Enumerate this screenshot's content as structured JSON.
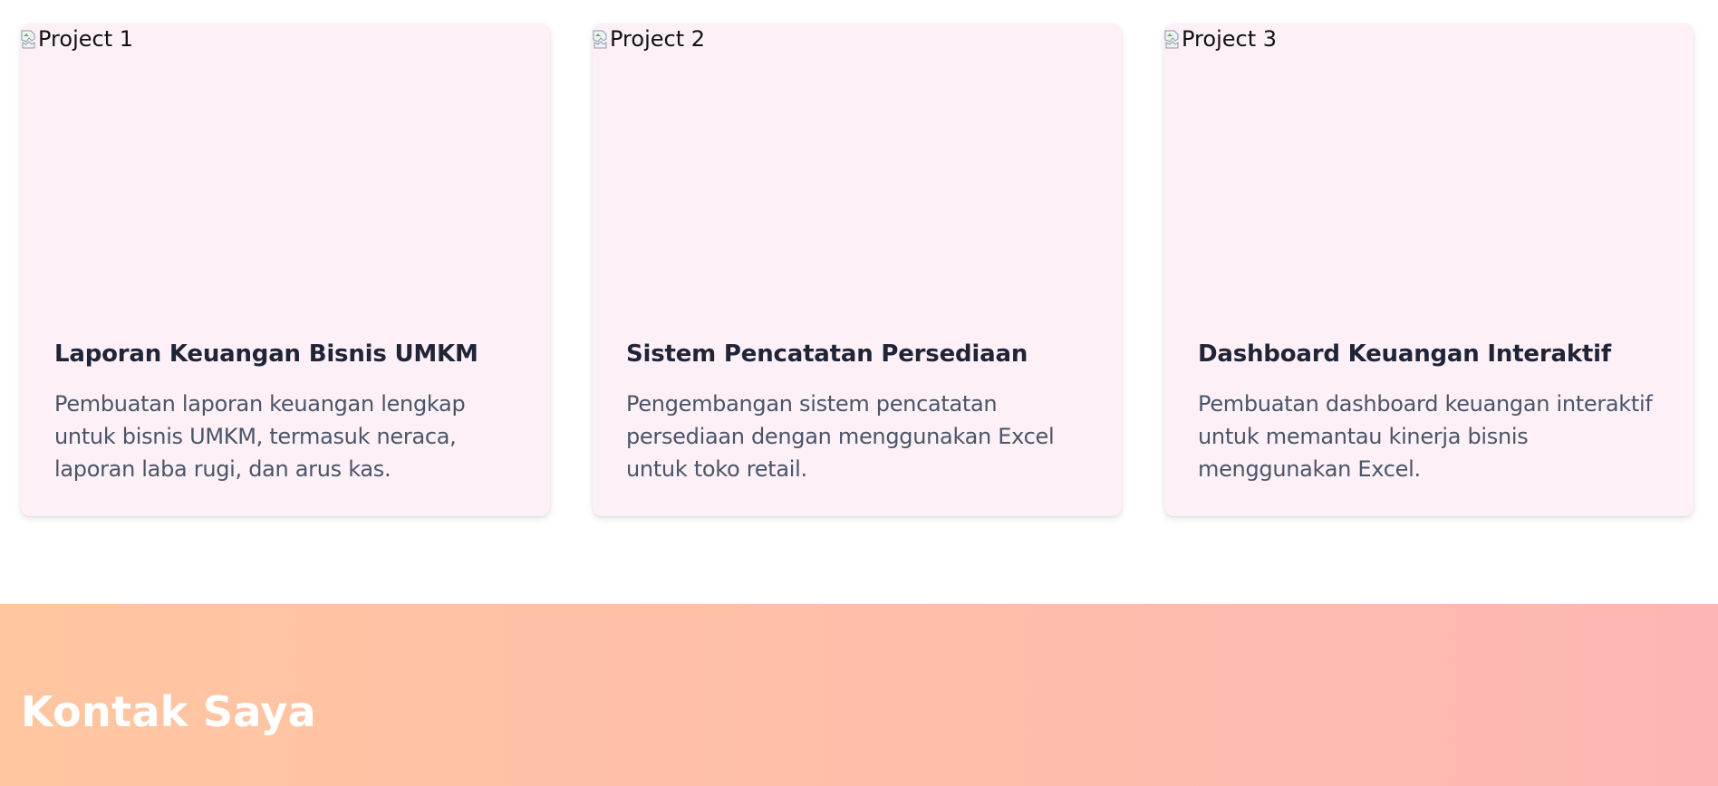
{
  "projects": [
    {
      "image_alt": "Project 1",
      "title": "Laporan Keuangan Bisnis UMKM",
      "description": "Pembuatan laporan keuangan lengkap untuk bisnis UMKM, termasuk neraca, laporan laba rugi, dan arus kas."
    },
    {
      "image_alt": "Project 2",
      "title": "Sistem Pencatatan Persediaan",
      "description": "Pengembangan sistem pencatatan persediaan dengan menggunakan Excel untuk toko retail."
    },
    {
      "image_alt": "Project 3",
      "title": "Dashboard Keuangan Interaktif",
      "description": "Pembuatan dashboard keuangan interaktif untuk memantau kinerja bisnis menggunakan Excel."
    }
  ],
  "contact": {
    "title": "Kontak Saya"
  },
  "colors": {
    "card_background": "#fdf0f6",
    "title_text": "#1f2437",
    "description_text": "#4a5568",
    "contact_gradient_start": "#ffc6a0",
    "contact_gradient_end": "#feb6b4",
    "contact_title": "#ffffff"
  },
  "icons": {
    "broken_image": "broken-image-icon"
  }
}
